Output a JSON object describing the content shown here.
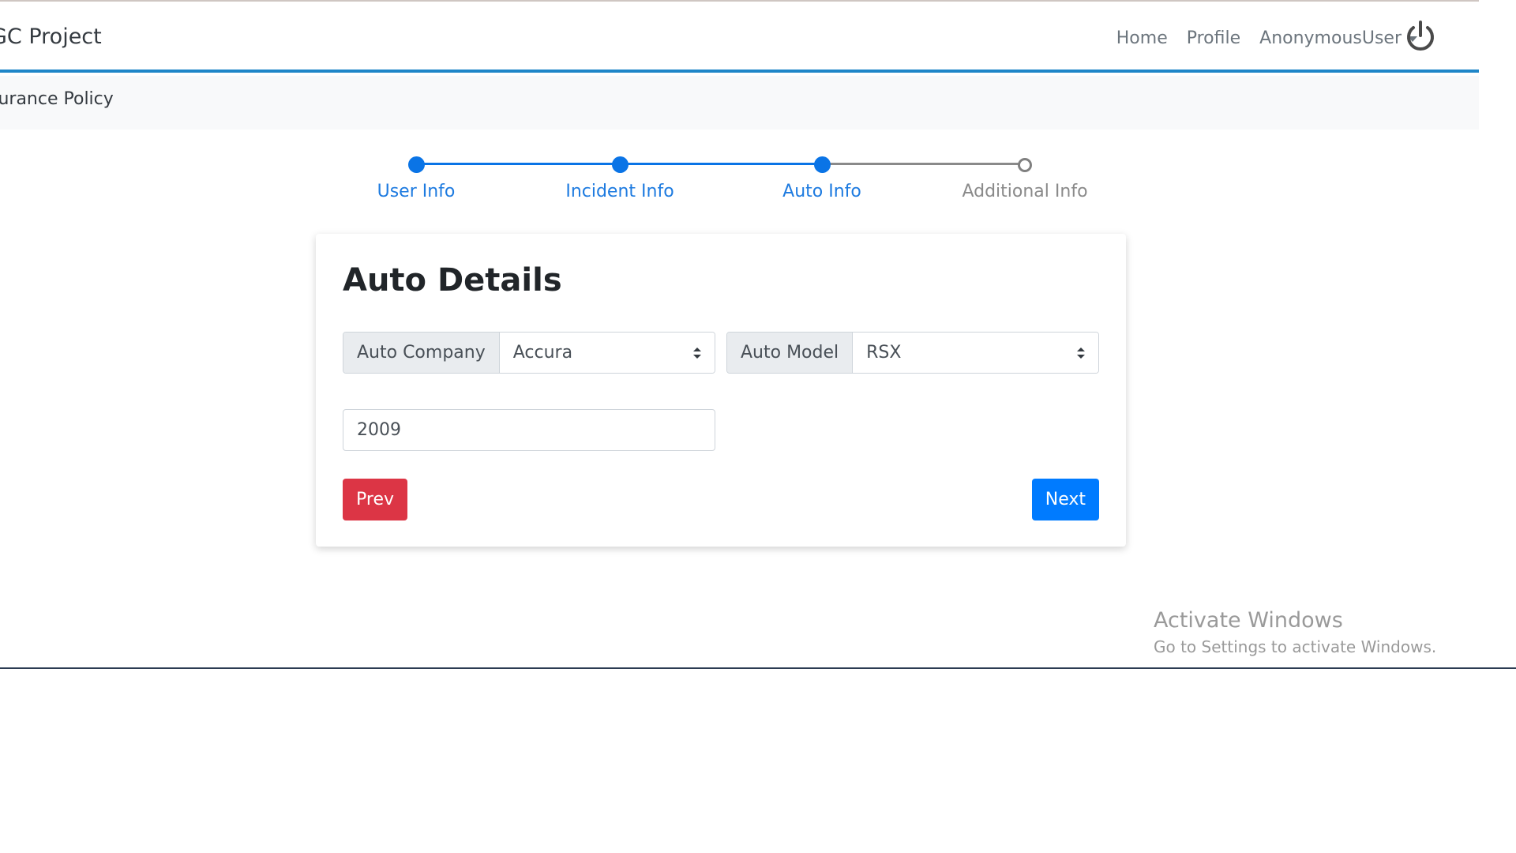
{
  "navbar": {
    "brand": "GC Project",
    "links": [
      "Home",
      "Profile"
    ],
    "user": "AnonymousUser"
  },
  "subbar": {
    "title": "surance Policy"
  },
  "stepper": {
    "steps": [
      {
        "label": "User Info",
        "active": true
      },
      {
        "label": "Incident Info",
        "active": true
      },
      {
        "label": "Auto Info",
        "active": true
      },
      {
        "label": "Additional Info",
        "active": false
      }
    ]
  },
  "form": {
    "title": "Auto Details",
    "auto_company_label": "Auto Company",
    "auto_company_value": "Accura",
    "auto_model_label": "Auto Model",
    "auto_model_value": "RSX",
    "year_value": "2009",
    "prev_label": "Prev",
    "next_label": "Next"
  },
  "watermark": {
    "title": "Activate Windows",
    "subtitle": "Go to Settings to activate Windows."
  },
  "colors": {
    "accent": "#007bff",
    "danger": "#dc3545",
    "navbar_border": "#1f86c8",
    "step_active": "#0a74e6"
  }
}
